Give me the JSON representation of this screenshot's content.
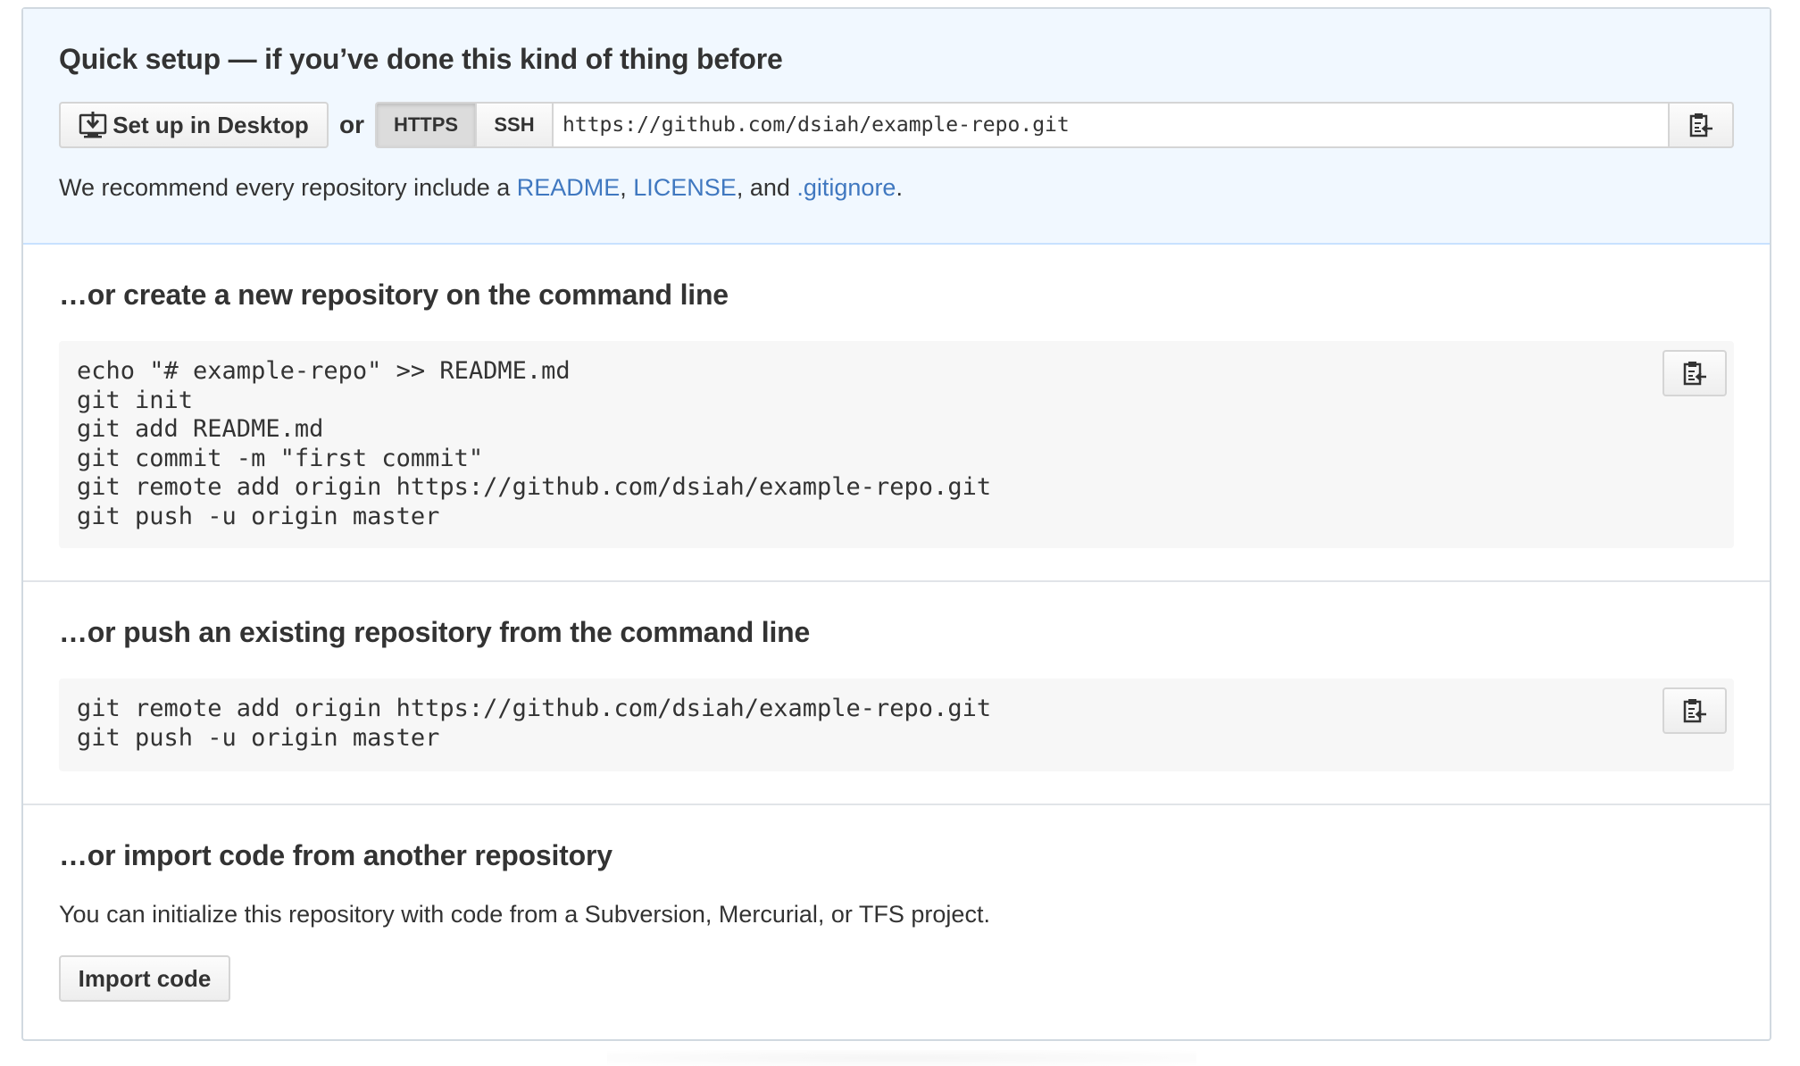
{
  "quick_setup": {
    "title": "Quick setup — if you’ve done this kind of thing before",
    "desktop_button_label": "Set up in Desktop",
    "or_label": "or",
    "protocol_tabs": [
      "HTTPS",
      "SSH"
    ],
    "selected_protocol": "HTTPS",
    "clone_url": "https://github.com/dsiah/example-repo.git",
    "recommend": {
      "prefix": "We recommend every repository include a ",
      "readme": "README",
      "sep1": ", ",
      "license": "LICENSE",
      "sep2": ", and ",
      "gitignore": ".gitignore",
      "suffix": "."
    }
  },
  "create_section": {
    "title": "…or create a new repository on the command line",
    "code": "echo \"# example-repo\" >> README.md\ngit init\ngit add README.md\ngit commit -m \"first commit\"\ngit remote add origin https://github.com/dsiah/example-repo.git\ngit push -u origin master"
  },
  "push_section": {
    "title": "…or push an existing repository from the command line",
    "code": "git remote add origin https://github.com/dsiah/example-repo.git\ngit push -u origin master"
  },
  "import_section": {
    "title": "…or import code from another repository",
    "text": "You can initialize this repository with code from a Subversion, Mercurial, or TFS project.",
    "button_label": "Import code"
  },
  "icons": {
    "desktop": "desktop-download-icon",
    "clipboard": "clipboard-icon"
  },
  "colors": {
    "quick_setup_bg": "#f1f8ff",
    "link": "#4078c0",
    "code_bg": "#f7f7f7",
    "border": "#d1d9e0"
  }
}
